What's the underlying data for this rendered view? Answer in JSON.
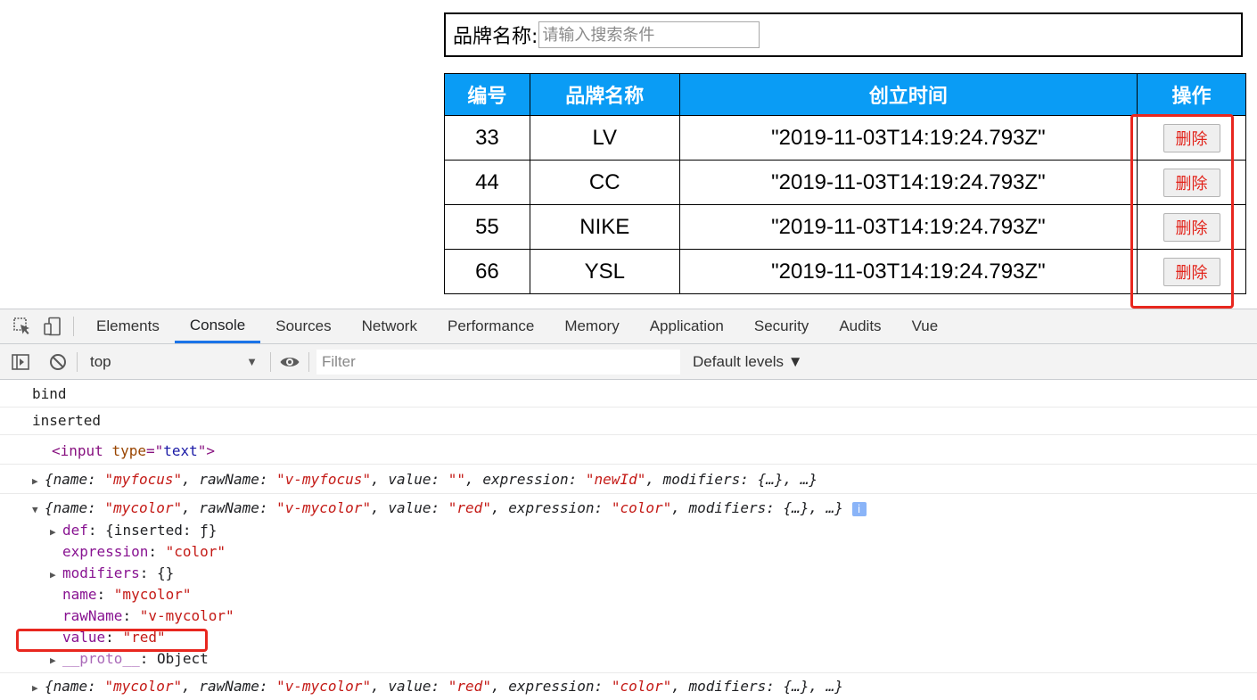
{
  "search": {
    "label": "品牌名称:",
    "placeholder": "请输入搜索条件"
  },
  "table": {
    "headers": [
      "编号",
      "品牌名称",
      "创立时间",
      "操作"
    ],
    "rows": [
      {
        "id": "33",
        "name": "LV",
        "time": "\"2019-11-03T14:19:24.793Z\"",
        "action": "删除"
      },
      {
        "id": "44",
        "name": "CC",
        "time": "\"2019-11-03T14:19:24.793Z\"",
        "action": "删除"
      },
      {
        "id": "55",
        "name": "NIKE",
        "time": "\"2019-11-03T14:19:24.793Z\"",
        "action": "删除"
      },
      {
        "id": "66",
        "name": "YSL",
        "time": "\"2019-11-03T14:19:24.793Z\"",
        "action": "删除"
      }
    ]
  },
  "devtools": {
    "tabs": [
      "Elements",
      "Console",
      "Sources",
      "Network",
      "Performance",
      "Memory",
      "Application",
      "Security",
      "Audits",
      "Vue"
    ],
    "active_tab": "Console",
    "context": "top",
    "filter_placeholder": "Filter",
    "levels": "Default levels ▼"
  },
  "console": {
    "bind": "bind",
    "inserted": "inserted",
    "element": {
      "tag": "input",
      "attr": "type",
      "value": "text"
    },
    "line1": {
      "name": "\"myfocus\"",
      "rawName": "\"v-myfocus\"",
      "value": "\"\"",
      "expression": "\"newId\""
    },
    "line2": {
      "name": "\"mycolor\"",
      "rawName": "\"v-mycolor\"",
      "value": "\"red\"",
      "expression": "\"color\""
    },
    "expanded": {
      "def_key": "def",
      "def_val": "{inserted: ƒ}",
      "expression_key": "expression",
      "expression_val": "\"color\"",
      "modifiers_key": "modifiers",
      "modifiers_val": "{}",
      "name_key": "name",
      "name_val": "\"mycolor\"",
      "rawName_key": "rawName",
      "rawName_val": "\"v-mycolor\"",
      "value_key": "value",
      "value_val": "\"red\"",
      "proto_key": "__proto__",
      "proto_val": "Object"
    },
    "line3": {
      "name": "\"mycolor\"",
      "rawName": "\"v-mycolor\"",
      "value": "\"red\"",
      "expression": "\"color\""
    }
  },
  "colors": {
    "header_bg": "#0a9cf5",
    "delete_text": "#e2231a",
    "highlight": "#e8271f",
    "active_tab": "#1a73e8"
  }
}
